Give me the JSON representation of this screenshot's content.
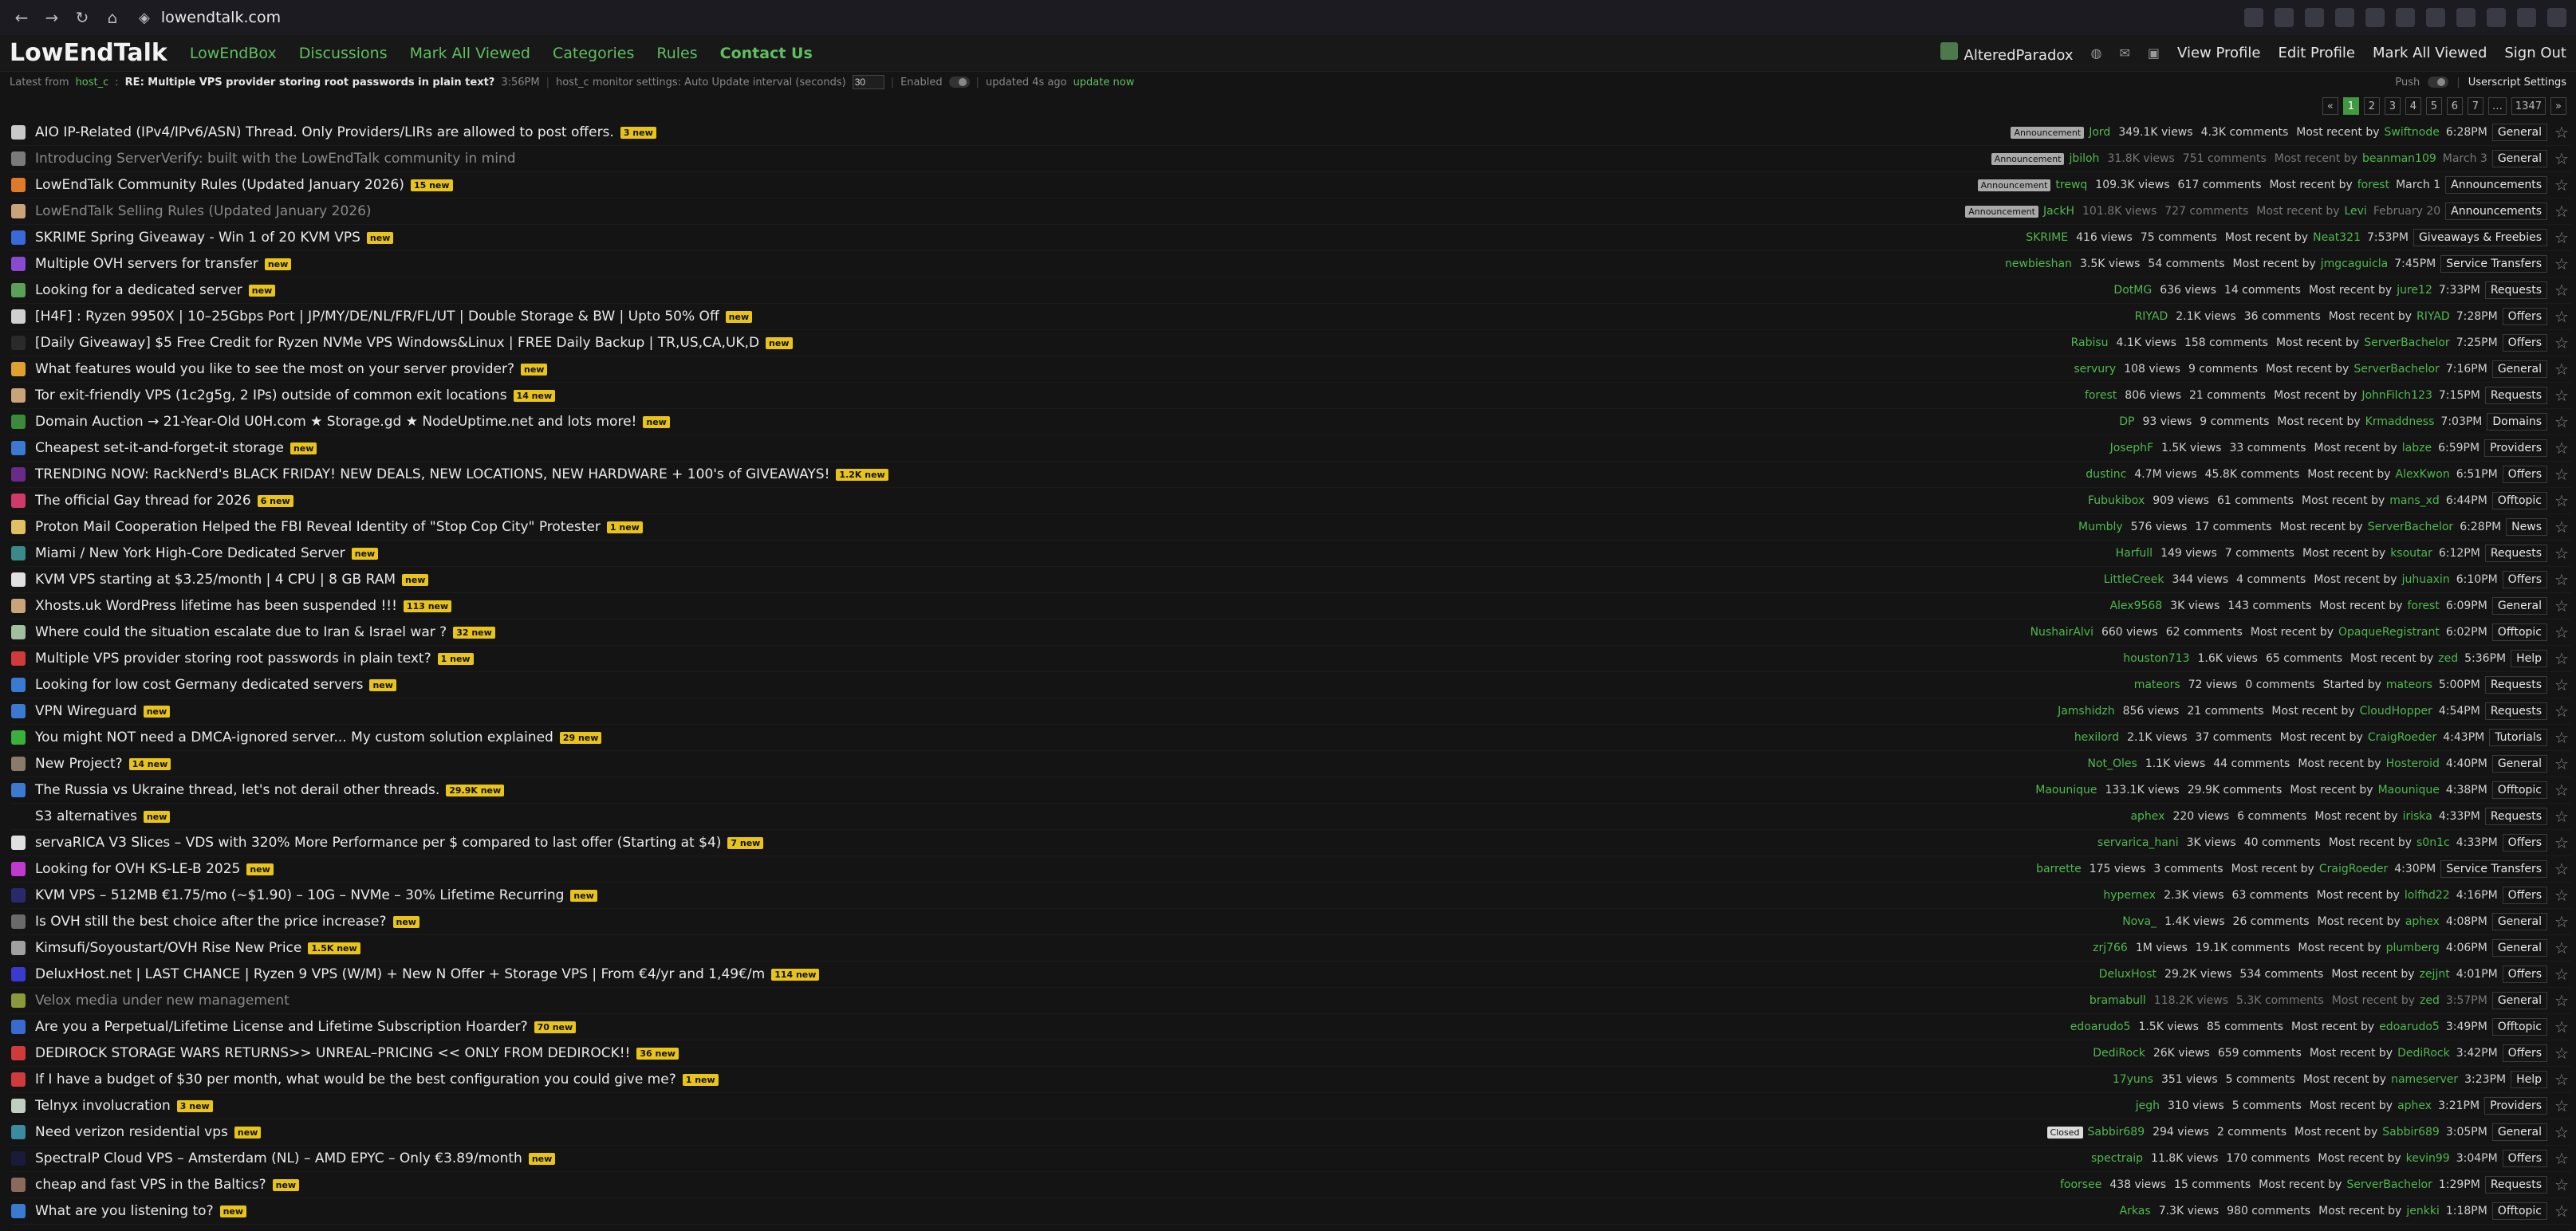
{
  "browser": {
    "url": "lowendtalk.com"
  },
  "site": {
    "logo": "LowEndTalk",
    "nav": [
      "LowEndBox",
      "Discussions",
      "Mark All Viewed",
      "Categories",
      "Rules",
      "Contact Us"
    ],
    "user": {
      "name": "AlteredParadox",
      "links": [
        "View Profile",
        "Edit Profile",
        "Mark All Viewed",
        "Sign Out"
      ]
    }
  },
  "subbar": {
    "latest_prefix": "Latest from",
    "latest_user": "host_c",
    "latest_title": "RE: Multiple VPS provider storing root passwords in plain text?",
    "latest_time": "3:56PM",
    "monitor_label": "host_c monitor settings: Auto Update interval (seconds)",
    "interval": "30",
    "enabled_label": "Enabled",
    "updated": "updated 4s ago",
    "update_now": "update now",
    "push_label": "Push",
    "userscript": "Userscript Settings"
  },
  "pagination": [
    "«",
    "1",
    "2",
    "3",
    "4",
    "5",
    "6",
    "7",
    "…",
    "1347",
    "»"
  ],
  "threads": [
    {
      "title": "AIO IP-Related (IPv4/IPv6/ASN) Thread. Only Providers/LIRs are allowed to post offers.",
      "badge": "3 new",
      "announcement": "Announcement",
      "author": "Jord",
      "views": "349.1K views",
      "comments": "4.3K comments",
      "recent_label": "Most recent by",
      "last": "Swiftnode",
      "time": "6:28PM",
      "category": "General",
      "icon_color": "#c9c9c9",
      "read": false
    },
    {
      "title": "Introducing ServerVerify: built with the LowEndTalk community in mind",
      "badge": "",
      "announcement": "Announcement",
      "author": "jbiloh",
      "views": "31.8K views",
      "comments": "751 comments",
      "recent_label": "Most recent by",
      "last": "beanman109",
      "time": "March 3",
      "category": "General",
      "icon_color": "#7a7a7a",
      "read": true
    },
    {
      "title": "LowEndTalk Community Rules (Updated January 2026)",
      "badge": "15 new",
      "announcement": "Announcement",
      "author": "trewq",
      "views": "109.3K views",
      "comments": "617 comments",
      "recent_label": "Most recent by",
      "last": "forest",
      "time": "March 1",
      "category": "Announcements",
      "icon_color": "#e07a2a",
      "read": false
    },
    {
      "title": "LowEndTalk Selling Rules (Updated January 2026)",
      "badge": "",
      "announcement": "Announcement",
      "author": "JackH",
      "views": "101.8K views",
      "comments": "727 comments",
      "recent_label": "Most recent by",
      "last": "Levi",
      "time": "February 20",
      "category": "Announcements",
      "icon_color": "#c9a37a",
      "read": true
    },
    {
      "title": "SKRIME Spring Giveaway - Win 1 of 20 KVM VPS",
      "badge": "new",
      "announcement": "",
      "author": "SKRIME",
      "views": "416 views",
      "comments": "75 comments",
      "recent_label": "Most recent by",
      "last": "Neat321",
      "time": "7:53PM",
      "category": "Giveaways & Freebies",
      "icon_color": "#3a6ad8",
      "read": false
    },
    {
      "title": "Multiple OVH servers for transfer",
      "badge": "new",
      "announcement": "",
      "author": "newbieshan",
      "views": "3.5K views",
      "comments": "54 comments",
      "recent_label": "Most recent by",
      "last": "jmgcaguicla",
      "time": "7:45PM",
      "category": "Service Transfers",
      "icon_color": "#8a4ad0",
      "read": false
    },
    {
      "title": "Looking for a dedicated server",
      "badge": "new",
      "announcement": "",
      "author": "DotMG",
      "views": "636 views",
      "comments": "14 comments",
      "recent_label": "Most recent by",
      "last": "jure12",
      "time": "7:33PM",
      "category": "Requests",
      "icon_color": "#5aa05a",
      "read": false
    },
    {
      "title": "[H4F] : Ryzen 9950X | 10–25Gbps Port | JP/MY/DE/NL/FR/FL/UT | Double Storage & BW | Upto 50% Off",
      "badge": "new",
      "announcement": "",
      "author": "RIYAD",
      "views": "2.1K views",
      "comments": "36 comments",
      "recent_label": "Most recent by",
      "last": "RIYAD",
      "time": "7:28PM",
      "category": "Offers",
      "icon_color": "#d0d0d0",
      "read": false
    },
    {
      "title": "[Daily Giveaway] $5 Free Credit for Ryzen NVMe VPS Windows&Linux | FREE Daily Backup | TR,US,CA,UK,D",
      "badge": "new",
      "announcement": "",
      "author": "Rabisu",
      "views": "4.1K views",
      "comments": "158 comments",
      "recent_label": "Most recent by",
      "last": "ServerBachelor",
      "time": "7:25PM",
      "category": "Offers",
      "icon_color": "#2a2a2a",
      "read": false
    },
    {
      "title": "What features would you like to see the most on your server provider?",
      "badge": "new",
      "announcement": "",
      "author": "servury",
      "views": "108 views",
      "comments": "9 comments",
      "recent_label": "Most recent by",
      "last": "ServerBachelor",
      "time": "7:16PM",
      "category": "General",
      "icon_color": "#e0a030",
      "read": false
    },
    {
      "title": "Tor exit-friendly VPS (1c2g5g, 2 IPs) outside of common exit locations",
      "badge": "14 new",
      "announcement": "",
      "author": "forest",
      "views": "806 views",
      "comments": "21 comments",
      "recent_label": "Most recent by",
      "last": "JohnFilch123",
      "time": "7:15PM",
      "category": "Requests",
      "icon_color": "#c9a37a",
      "read": false
    },
    {
      "title": "Domain Auction → 21-Year-Old U0H.com ★ Storage.gd ★ NodeUptime.net and lots more!",
      "badge": "new",
      "announcement": "",
      "author": "DP",
      "views": "93 views",
      "comments": "9 comments",
      "recent_label": "Most recent by",
      "last": "Krmaddness",
      "time": "7:03PM",
      "category": "Domains",
      "icon_color": "#3a8a3a",
      "read": false
    },
    {
      "title": "Cheapest set-it-and-forget-it storage",
      "badge": "new",
      "announcement": "",
      "author": "JosephF",
      "views": "1.5K views",
      "comments": "33 comments",
      "recent_label": "Most recent by",
      "last": "labze",
      "time": "6:59PM",
      "category": "Providers",
      "icon_color": "#3a7ad0",
      "read": false
    },
    {
      "title": "TRENDING NOW: RackNerd's BLACK FRIDAY! NEW DEALS, NEW LOCATIONS, NEW HARDWARE + 100's of GIVEAWAYS!",
      "badge": "1.2K new",
      "announcement": "",
      "author": "dustinc",
      "views": "4.7M views",
      "comments": "45.8K comments",
      "recent_label": "Most recent by",
      "last": "AlexKwon",
      "time": "6:51PM",
      "category": "Offers",
      "icon_color": "#6a2a8a",
      "read": false
    },
    {
      "title": "The official Gay thread for 2026",
      "badge": "6 new",
      "announcement": "",
      "author": "Fubukibox",
      "views": "909 views",
      "comments": "61 comments",
      "recent_label": "Most recent by",
      "last": "mans_xd",
      "time": "6:44PM",
      "category": "Offtopic",
      "icon_color": "#d03a6a",
      "read": false
    },
    {
      "title": "Proton Mail Cooperation Helped the FBI Reveal Identity of \"Stop Cop City\" Protester",
      "badge": "1 new",
      "announcement": "",
      "author": "Mumbly",
      "views": "576 views",
      "comments": "17 comments",
      "recent_label": "Most recent by",
      "last": "ServerBachelor",
      "time": "6:28PM",
      "category": "News",
      "icon_color": "#e0c060",
      "read": false
    },
    {
      "title": "Miami / New York High-Core Dedicated Server",
      "badge": "new",
      "announcement": "",
      "author": "Harfull",
      "views": "149 views",
      "comments": "7 comments",
      "recent_label": "Most recent by",
      "last": "ksoutar",
      "time": "6:12PM",
      "category": "Requests",
      "icon_color": "#3a8a8a",
      "read": false
    },
    {
      "title": "KVM VPS starting at $3.25/month | 4 CPU | 8 GB RAM",
      "badge": "new",
      "announcement": "",
      "author": "LittleCreek",
      "views": "344 views",
      "comments": "4 comments",
      "recent_label": "Most recent by",
      "last": "juhuaxin",
      "time": "6:10PM",
      "category": "Offers",
      "icon_color": "#e0e0e0",
      "read": false
    },
    {
      "title": "Xhosts.uk WordPress lifetime has been suspended !!!",
      "badge": "113 new",
      "announcement": "",
      "author": "Alex9568",
      "views": "3K views",
      "comments": "143 comments",
      "recent_label": "Most recent by",
      "last": "forest",
      "time": "6:09PM",
      "category": "General",
      "icon_color": "#c9a37a",
      "read": false
    },
    {
      "title": "Where could the situation escalate due to Iran & Israel war ?",
      "badge": "32 new",
      "announcement": "",
      "author": "NushairAlvi",
      "views": "660 views",
      "comments": "62 comments",
      "recent_label": "Most recent by",
      "last": "OpaqueRegistrant",
      "time": "6:02PM",
      "category": "Offtopic",
      "icon_color": "#a0c0a0",
      "read": false
    },
    {
      "title": "Multiple VPS provider storing root passwords in plain text?",
      "badge": "1 new",
      "announcement": "",
      "author": "houston713",
      "views": "1.6K views",
      "comments": "65 comments",
      "recent_label": "Most recent by",
      "last": "zed",
      "time": "5:36PM",
      "category": "Help",
      "icon_color": "#d03a3a",
      "read": false
    },
    {
      "title": "Looking for low cost Germany dedicated servers",
      "badge": "new",
      "announcement": "",
      "author": "mateors",
      "views": "72 views",
      "comments": "0 comments",
      "recent_label": "Started by",
      "last": "mateors",
      "time": "5:00PM",
      "category": "Requests",
      "icon_color": "#3a7ad0",
      "read": false
    },
    {
      "title": "VPN Wireguard",
      "badge": "new",
      "announcement": "",
      "author": "Jamshidzh",
      "views": "856 views",
      "comments": "21 comments",
      "recent_label": "Most recent by",
      "last": "CloudHopper",
      "time": "4:54PM",
      "category": "Requests",
      "icon_color": "#3a7ad0",
      "read": false
    },
    {
      "title": "You might NOT need a DMCA-ignored server... My custom solution explained",
      "badge": "29 new",
      "announcement": "",
      "author": "hexilord",
      "views": "2.1K views",
      "comments": "37 comments",
      "recent_label": "Most recent by",
      "last": "CraigRoeder",
      "time": "4:43PM",
      "category": "Tutorials",
      "icon_color": "#3ab03a",
      "read": false
    },
    {
      "title": "New Project?",
      "badge": "14 new",
      "announcement": "",
      "author": "Not_Oles",
      "views": "1.1K views",
      "comments": "44 comments",
      "recent_label": "Most recent by",
      "last": "Hosteroid",
      "time": "4:40PM",
      "category": "General",
      "icon_color": "#8a7a6a",
      "read": false
    },
    {
      "title": "The Russia vs Ukraine thread, let's not derail other threads.",
      "badge": "29.9K new",
      "announcement": "",
      "author": "Maounique",
      "views": "133.1K views",
      "comments": "29.9K comments",
      "recent_label": "Most recent by",
      "last": "Maounique",
      "time": "4:38PM",
      "category": "Offtopic",
      "icon_color": "#3a7ad0",
      "read": false
    },
    {
      "title": "S3 alternatives",
      "badge": "new",
      "announcement": "",
      "author": "aphex",
      "views": "220 views",
      "comments": "6 comments",
      "recent_label": "Most recent by",
      "last": "iriska",
      "time": "4:33PM",
      "category": "Requests",
      "icon_color": "#141414",
      "read": false
    },
    {
      "title": "servaRICA V3 Slices – VDS with 320% More Performance per $ compared to last offer (Starting at $4)",
      "badge": "7 new",
      "announcement": "",
      "author": "servarica_hani",
      "views": "3K views",
      "comments": "40 comments",
      "recent_label": "Most recent by",
      "last": "s0n1c",
      "time": "4:33PM",
      "category": "Offers",
      "icon_color": "#e0e0e0",
      "read": false
    },
    {
      "title": "Looking for OVH KS-LE-B 2025",
      "badge": "new",
      "announcement": "",
      "author": "barrette",
      "views": "175 views",
      "comments": "3 comments",
      "recent_label": "Most recent by",
      "last": "CraigRoeder",
      "time": "4:30PM",
      "category": "Service Transfers",
      "icon_color": "#c03ad0",
      "read": false
    },
    {
      "title": "KVM VPS – 512MB €1.75/mo (~$1.90) – 10G – NVMe – 30% Lifetime Recurring",
      "badge": "new",
      "announcement": "",
      "author": "hypernex",
      "views": "2.3K views",
      "comments": "63 comments",
      "recent_label": "Most recent by",
      "last": "lolfhd22",
      "time": "4:16PM",
      "category": "Offers",
      "icon_color": "#2a2a6a",
      "read": false
    },
    {
      "title": "Is OVH still the best choice after the price increase?",
      "badge": "new",
      "announcement": "",
      "author": "Nova_",
      "views": "1.4K views",
      "comments": "26 comments",
      "recent_label": "Most recent by",
      "last": "aphex",
      "time": "4:08PM",
      "category": "General",
      "icon_color": "#6a6a6a",
      "read": false
    },
    {
      "title": "Kimsufi/Soyoustart/OVH Rise New Price",
      "badge": "1.5K new",
      "announcement": "",
      "author": "zrj766",
      "views": "1M views",
      "comments": "19.1K comments",
      "recent_label": "Most recent by",
      "last": "plumberg",
      "time": "4:06PM",
      "category": "General",
      "icon_color": "#a0a0a0",
      "read": false
    },
    {
      "title": "DeluxHost.net | LAST CHANCE | Ryzen 9 VPS (W/M) + New N Offer + Storage VPS | From €4/yr and 1,49€/m",
      "badge": "114 new",
      "announcement": "",
      "author": "DeluxHost",
      "views": "29.2K views",
      "comments": "534 comments",
      "recent_label": "Most recent by",
      "last": "zejjnt",
      "time": "4:01PM",
      "category": "Offers",
      "icon_color": "#3a3ad0",
      "read": false
    },
    {
      "title": "Velox media under new management",
      "badge": "",
      "announcement": "",
      "author": "bramabull",
      "views": "118.2K views",
      "comments": "5.3K comments",
      "recent_label": "Most recent by",
      "last": "zed",
      "time": "3:57PM",
      "category": "General",
      "icon_color": "#8a9a3a",
      "read": true
    },
    {
      "title": "Are you a Perpetual/Lifetime License and Lifetime Subscription Hoarder?",
      "badge": "70 new",
      "announcement": "",
      "author": "edoarudo5",
      "views": "1.5K views",
      "comments": "85 comments",
      "recent_label": "Most recent by",
      "last": "edoarudo5",
      "time": "3:49PM",
      "category": "Offtopic",
      "icon_color": "#3a6ad0",
      "read": false
    },
    {
      "title": "DEDIROCK STORAGE WARS RETURNS>> UNREAL–PRICING << ONLY FROM DEDIROCK!!",
      "badge": "36 new",
      "announcement": "",
      "author": "DediRock",
      "views": "26K views",
      "comments": "659 comments",
      "recent_label": "Most recent by",
      "last": "DediRock",
      "time": "3:42PM",
      "category": "Offers",
      "icon_color": "#d03a3a",
      "read": false
    },
    {
      "title": "If I have a budget of $30 per month, what would be the best configuration you could give me?",
      "badge": "1 new",
      "announcement": "",
      "author": "17yuns",
      "views": "351 views",
      "comments": "5 comments",
      "recent_label": "Most recent by",
      "last": "nameserver",
      "time": "3:23PM",
      "category": "Help",
      "icon_color": "#d03a3a",
      "read": false
    },
    {
      "title": "Telnyx involucration",
      "badge": "3 new",
      "announcement": "",
      "author": "jegh",
      "views": "310 views",
      "comments": "5 comments",
      "recent_label": "Most recent by",
      "last": "aphex",
      "time": "3:21PM",
      "category": "Providers",
      "icon_color": "#c0d0c0",
      "read": false
    },
    {
      "title": "Need verizon residential vps",
      "badge": "new",
      "announcement": "Closed",
      "author": "Sabbir689",
      "views": "294 views",
      "comments": "2 comments",
      "recent_label": "Most recent by",
      "last": "Sabbir689",
      "time": "3:05PM",
      "category": "General",
      "icon_color": "#3a8aa0",
      "read": false
    },
    {
      "title": "SpectraIP Cloud VPS – Amsterdam (NL) – AMD EPYC – Only €3.89/month",
      "badge": "new",
      "announcement": "",
      "author": "spectraip",
      "views": "11.8K views",
      "comments": "170 comments",
      "recent_label": "Most recent by",
      "last": "kevin99",
      "time": "3:04PM",
      "category": "Offers",
      "icon_color": "#1a1a3a",
      "read": false
    },
    {
      "title": "cheap and fast VPS in the Baltics?",
      "badge": "new",
      "announcement": "",
      "author": "foorsee",
      "views": "438 views",
      "comments": "15 comments",
      "recent_label": "Most recent by",
      "last": "ServerBachelor",
      "time": "1:29PM",
      "category": "Requests",
      "icon_color": "#8a6a5a",
      "read": false
    },
    {
      "title": "What are you listening to?",
      "badge": "new",
      "announcement": "",
      "author": "Arkas",
      "views": "7.3K views",
      "comments": "980 comments",
      "recent_label": "Most recent by",
      "last": "jenkki",
      "time": "1:18PM",
      "category": "Offtopic",
      "icon_color": "#3a7ad0",
      "read": false
    }
  ]
}
